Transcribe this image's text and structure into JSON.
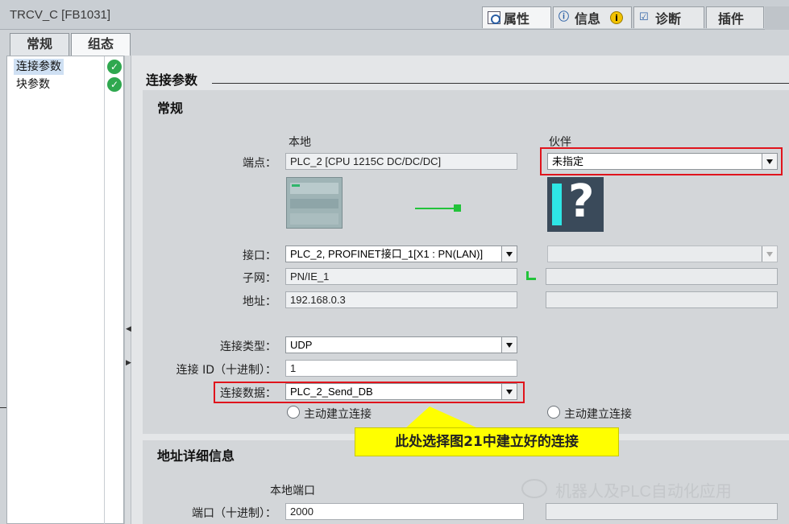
{
  "window": {
    "title": "TRCV_C [FB1031]"
  },
  "top_tabs": [
    {
      "label": "属性",
      "icon": "properties-icon"
    },
    {
      "label": "信息",
      "icon": "info-icon"
    },
    {
      "label": "诊断",
      "icon": "diagnostics-icon"
    },
    {
      "label": "插件",
      "icon": ""
    }
  ],
  "warning_glyph": "i",
  "sub_tabs": [
    {
      "label": "常规"
    },
    {
      "label": "组态",
      "active": true
    }
  ],
  "nav": {
    "items": [
      {
        "label": "连接参数",
        "selected": true,
        "status": "ok"
      },
      {
        "label": "块参数",
        "selected": false,
        "status": "ok"
      }
    ]
  },
  "main": {
    "title": "连接参数",
    "general": {
      "title": "常规",
      "local_head": "本地",
      "partner_head": "伙伴",
      "labels": {
        "endpoint": "端点：",
        "interface": "接口：",
        "subnet": "子网：",
        "address": "地址：",
        "conn_type": "连接类型：",
        "conn_id": "连接 ID（十进制）：",
        "conn_data": "连接数据："
      },
      "local": {
        "endpoint": "PLC_2 [CPU 1215C DC/DC/DC]",
        "interface": "PLC_2, PROFINET接口_1[X1 : PN(LAN)]",
        "subnet": "PN/IE_1",
        "address": "192.168.0.3",
        "conn_type": "UDP",
        "conn_id": "1",
        "conn_data": "PLC_2_Send_DB",
        "active_conn_label": "主动建立连接"
      },
      "partner": {
        "endpoint": "未指定",
        "interface": "",
        "subnet": "",
        "address": "",
        "active_conn_label": "主动建立连接"
      }
    },
    "address_details": {
      "title": "地址详细信息",
      "local_port_head": "本地端口",
      "port_label": "端口（十进制）：",
      "local_port": "2000",
      "partner_port": ""
    }
  },
  "callout": {
    "text": "此处选择图21中建立好的连接"
  },
  "watermark": {
    "text": "机器人及PLC自动化应用"
  },
  "colors": {
    "highlight_red": "#e0141c",
    "callout_yellow": "#ffff00",
    "status_green": "#2fa84f",
    "link_green": "#22c33a"
  }
}
